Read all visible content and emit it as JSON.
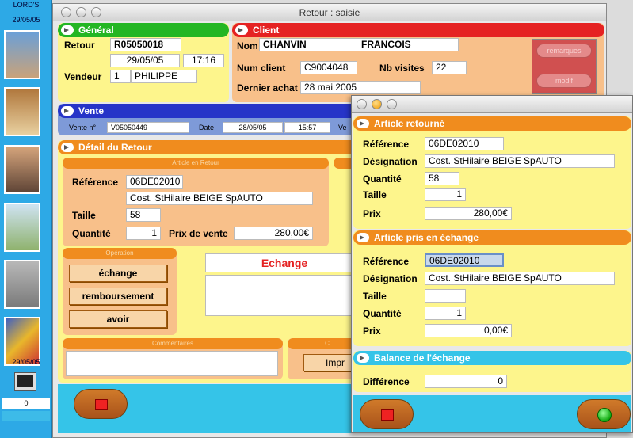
{
  "sidebar": {
    "brand": "LORD'S",
    "date": "29/05/05",
    "counter": "0",
    "icons": [
      "people-photo-icon",
      "store-shelves-icon",
      "shoppers-icon",
      "building-icon",
      "cash-register-icon",
      "credit-cards-icon",
      "monitor-icon"
    ]
  },
  "main_window": {
    "title": "Retour : saisie"
  },
  "general": {
    "header": "Général",
    "retour_label": "Retour",
    "retour_value": "R05050018",
    "date": "29/05/05",
    "time": "17:16",
    "vendeur_label": "Vendeur",
    "vendeur_num": "1",
    "vendeur_name": "PHILIPPE"
  },
  "client": {
    "header": "Client",
    "nom_label": "Nom",
    "last_name": "CHANVIN",
    "first_name": "FRANCOIS",
    "num_label": "Num client",
    "num_value": "C9004048",
    "visites_label": "Nb visites",
    "visites_value": "22",
    "dernier_label": "Dernier achat",
    "dernier_value": "28 mai 2005",
    "remarques_btn": "remarques",
    "modif_btn": "modif"
  },
  "vente": {
    "header": "Vente",
    "num_label": "Vente n°",
    "num_value": "V05050449",
    "date_label": "Date",
    "date_value": "28/05/05",
    "time_value": "15:57",
    "trunc_label": "Ve"
  },
  "detail": {
    "header": "Détail du Retour",
    "article_sub": "Article en Retour",
    "ref_label": "Référence",
    "ref_value": "06DE02010",
    "designation": "Cost. StHilaire BEIGE SpAUTO",
    "taille_label": "Taille",
    "taille_value": "58",
    "qte_label": "Quantité",
    "qte_value": "1",
    "prix_label": "Prix de vente",
    "prix_value": "280,00€",
    "operation_sub": "Opération",
    "btn_echange": "échange",
    "btn_remboursement": "remboursement",
    "btn_avoir": "avoir",
    "mode_label": "Echange",
    "commentaires_sub": "Commentaires",
    "c_sub": "C",
    "impr_btn": "Impr"
  },
  "popup": {
    "retourne": {
      "header": "Article retourné",
      "ref_label": "Référence",
      "ref_value": "06DE02010",
      "des_label": "Désignation",
      "des_value": "Cost. StHilaire BEIGE SpAUTO",
      "qte_label": "Quantité",
      "qte_value": "58",
      "taille_label": "Taille",
      "taille_value": "1",
      "prix_label": "Prix",
      "prix_value": "280,00€"
    },
    "echange": {
      "header": "Article pris en échange",
      "ref_label": "Référence",
      "ref_value": "06DE02010",
      "des_label": "Désignation",
      "des_value": "Cost. StHilaire BEIGE SpAUTO",
      "taille_label": "Taille",
      "taille_value": "",
      "qte_label": "Quantité",
      "qte_value": "1",
      "prix_label": "Prix",
      "prix_value": "0,00€"
    },
    "balance": {
      "header": "Balance de l'échange",
      "diff_label": "Différence",
      "diff_value": "0"
    }
  },
  "colors": {
    "general": "#23b623",
    "client": "#e52222",
    "vente": "#2634c8",
    "orange": "#f08c1e",
    "cyan": "#35c4e8",
    "yellow": "#fdf58c",
    "peach": "#f8c08a"
  }
}
